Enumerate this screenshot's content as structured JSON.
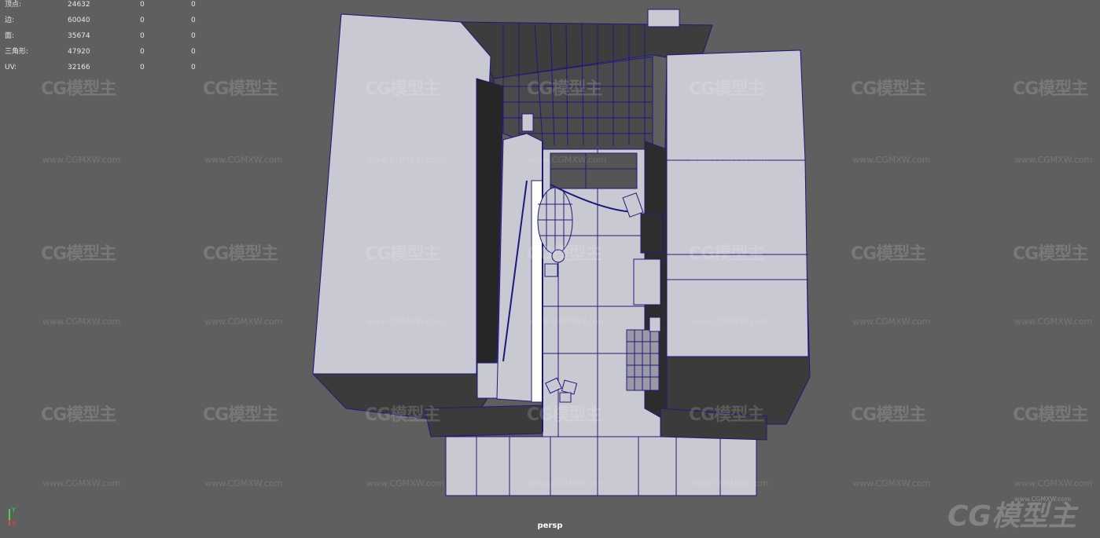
{
  "hud": {
    "rows": [
      {
        "label": "顶点:",
        "total": "24632",
        "selected": "0",
        "uv": "0"
      },
      {
        "label": "边:",
        "total": "60040",
        "selected": "0",
        "uv": "0"
      },
      {
        "label": "面:",
        "total": "35674",
        "selected": "0",
        "uv": "0"
      },
      {
        "label": "三角形:",
        "total": "47920",
        "selected": "0",
        "uv": "0"
      },
      {
        "label": "UV:",
        "total": "32166",
        "selected": "0",
        "uv": "0"
      }
    ]
  },
  "camera_label": "persp",
  "axis": {
    "y_label": "Y",
    "x_label": "X",
    "y_color": "#4fcf4f",
    "x_color": "#e04848"
  },
  "watermark": {
    "logo_text": "CG模型主",
    "url_text": "www.CGMXW.com"
  },
  "colors": {
    "background": "#5f5f5f",
    "surface": "#c8c8d0",
    "wireframe": "#1e1a7a",
    "shadow": "#3a3a3a"
  }
}
